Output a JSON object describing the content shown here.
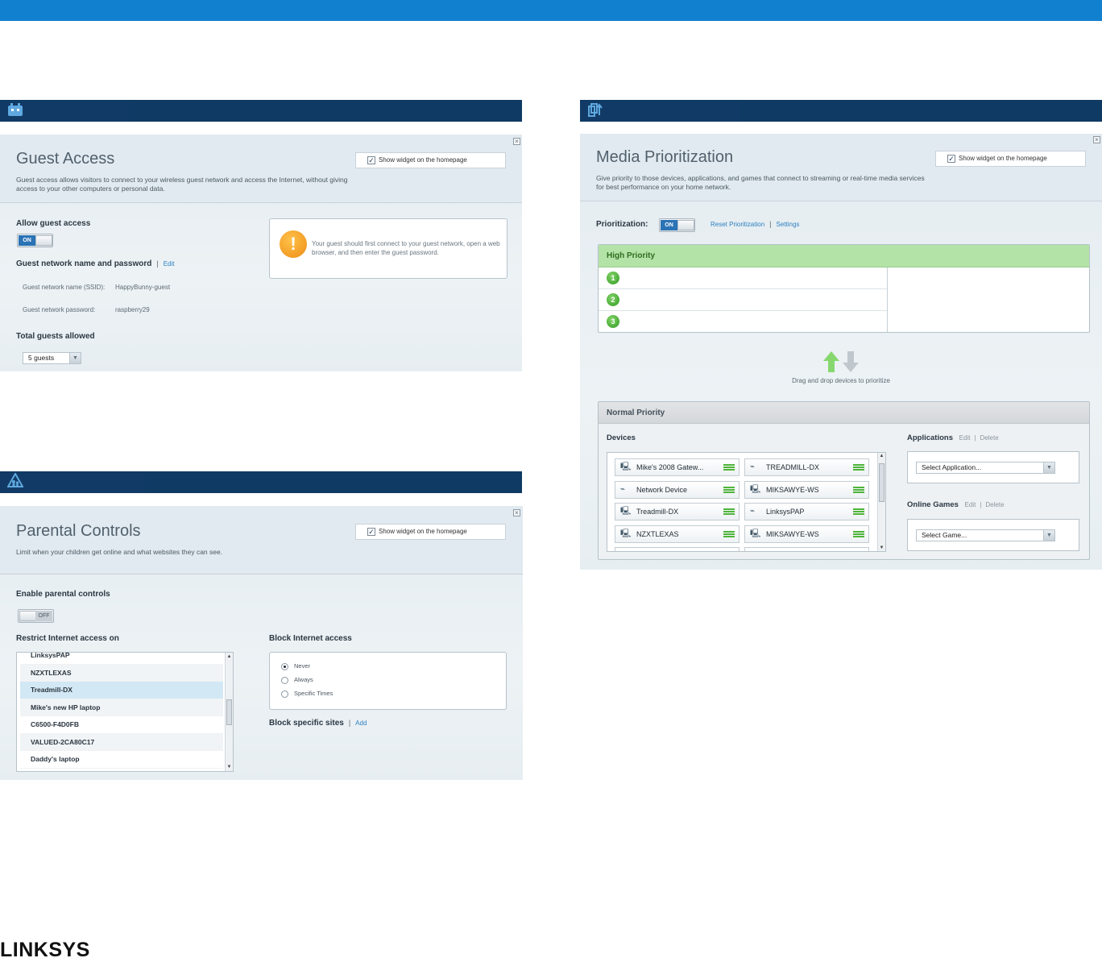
{
  "brand": {
    "logo_text": "LINKSYS",
    "topbar_color": "#1180ce",
    "section_color": "#0e3a63",
    "accent": "#2c7fc0"
  },
  "guest_access": {
    "section_icon": "guest-access-icon",
    "close": "×",
    "title": "Guest Access",
    "description": "Guest access allows visitors to connect to your wireless guest network and access the Internet, without giving access to your other computers or personal data.",
    "show_widget": "Show widget on the homepage",
    "allow_label": "Allow guest access",
    "toggle_on": "ON",
    "name_password_label": "Guest network name and password",
    "sep": "|",
    "edit": "Edit",
    "ssid_label": "Guest network name (SSID):",
    "ssid_value": "HappyBunny-guest",
    "password_label": "Guest network password:",
    "password_value": "raspberry29",
    "total_label": "Total guests allowed",
    "total_value": "5 guests",
    "notice": "Your guest should first connect to your guest network, open a web browser, and then enter the guest password."
  },
  "parental_controls": {
    "section_icon": "parental-controls-icon",
    "close": "×",
    "title": "Parental Controls",
    "description": "Limit when your children get online and what websites they can see.",
    "show_widget": "Show widget on the homepage",
    "enable_label": "Enable parental controls",
    "toggle_off": "OFF",
    "restrict_label": "Restrict Internet access on",
    "devices": [
      "LinksysPAP",
      "NZXTLEXAS",
      "Treadmill-DX",
      "Mike's new HP laptop",
      "C6500-F4D0FB",
      "VALUED-2CA80C17",
      "Daddy's laptop"
    ],
    "selected_device": "Treadmill-DX",
    "block_label": "Block Internet access",
    "block_options": [
      "Never",
      "Always",
      "Specific Times"
    ],
    "block_selected": "Never",
    "block_sites_label": "Block specific sites",
    "sep": "|",
    "add": "Add"
  },
  "media_prioritization": {
    "section_icon": "media-prioritization-icon",
    "close": "×",
    "title": "Media Prioritization",
    "description": "Give priority to those devices, applications, and games that connect to streaming or real-time media services for best performance on your home network.",
    "show_widget": "Show widget on the homepage",
    "prioritization_label": "Prioritization:",
    "toggle_on": "ON",
    "reset": "Reset Prioritization",
    "sep": "|",
    "settings": "Settings",
    "high_priority": "High Priority",
    "slots": [
      "1",
      "2",
      "3"
    ],
    "drag_hint": "Drag and drop devices to prioritize",
    "normal_priority": "Normal Priority",
    "devices_label": "Devices",
    "devices": [
      {
        "name": "Mike's 2008 Gatew...",
        "icon": "computer-icon"
      },
      {
        "name": "TREADMILL-DX",
        "icon": "router-icon"
      },
      {
        "name": "Network Device",
        "icon": "router-icon"
      },
      {
        "name": "MIKSAWYE-WS",
        "icon": "computer-icon"
      },
      {
        "name": "Treadmill-DX",
        "icon": "computer-icon"
      },
      {
        "name": "LinksysPAP",
        "icon": "router-icon"
      },
      {
        "name": "NZXTLEXAS",
        "icon": "computer-icon"
      },
      {
        "name": "MIKSAWYE-WS",
        "icon": "computer-icon"
      }
    ],
    "applications_label": "Applications",
    "edit": "Edit",
    "delete": "Delete",
    "select_application": "Select Application...",
    "online_games_label": "Online Games",
    "select_game": "Select Game..."
  }
}
